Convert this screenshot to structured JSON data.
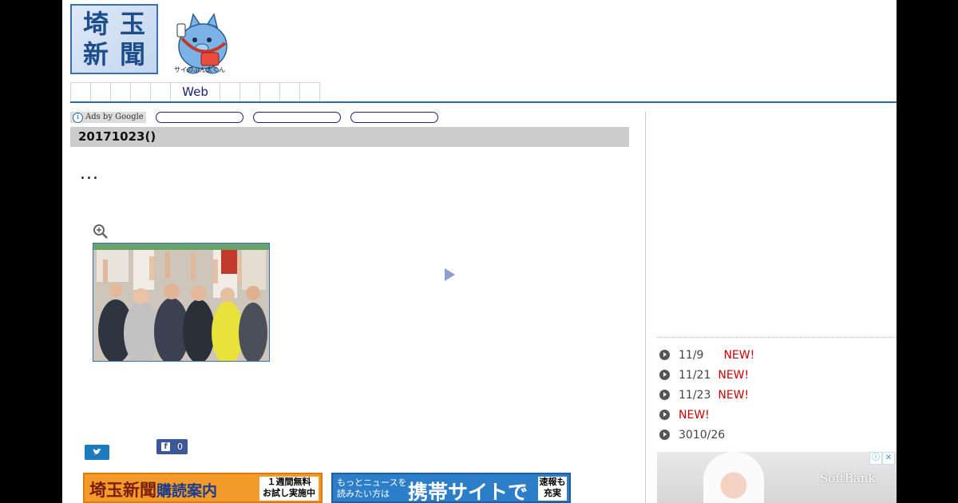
{
  "header": {
    "logo_chars": [
      "埼",
      "玉",
      "新",
      "聞"
    ],
    "mascot_caption": "サイのぶん太くん"
  },
  "nav": {
    "items": [
      "",
      "",
      "",
      "",
      "",
      "Web",
      "",
      "",
      "",
      "",
      ""
    ]
  },
  "ads_bar": {
    "label": "Ads by Google",
    "info_glyph": "i"
  },
  "article": {
    "date_title": "20171023()",
    "headline": "...",
    "zoom_icon": "zoom-in-icon"
  },
  "social": {
    "facebook_count": "0",
    "facebook_glyph": "f"
  },
  "banners": {
    "subscription": {
      "title_main": "埼玉新聞",
      "title_sub": "購読案内",
      "badge_line1": "１週間無料",
      "badge_line2": "お試し実施中"
    },
    "mobile": {
      "small_line1": "もっとニュースを",
      "small_line2": "読みたい方は",
      "main": "携帯サイトで",
      "badge_line1": "速報も",
      "badge_line2": "充実"
    }
  },
  "sidebar": {
    "news": [
      {
        "date": "11/9",
        "label": "",
        "new": "NEW!"
      },
      {
        "date": "11/21",
        "label": "",
        "new": "NEW!"
      },
      {
        "date": "11/23",
        "label": "",
        "new": "NEW!"
      },
      {
        "date": "",
        "label": "",
        "new": "NEW!"
      },
      {
        "date": "3010/26",
        "label": "",
        "new": ""
      }
    ],
    "ad": {
      "brand": "SoftBank",
      "info_glyph": "ⓘ",
      "close_glyph": "✕"
    }
  }
}
